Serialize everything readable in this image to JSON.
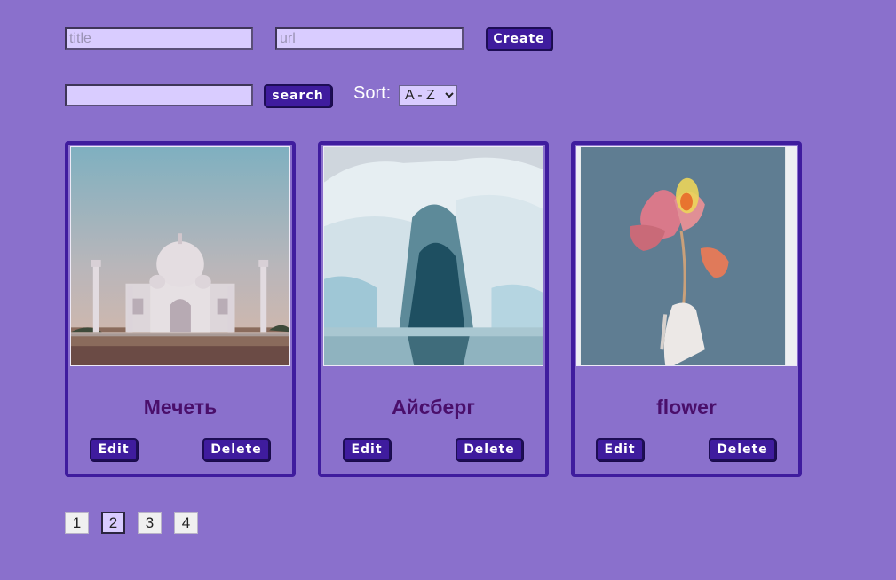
{
  "create_form": {
    "title_placeholder": "title",
    "url_placeholder": "url",
    "create_label": "Create"
  },
  "search_bar": {
    "search_value": "",
    "search_label": "search"
  },
  "sort": {
    "label": "Sort:",
    "selected": "A - Z",
    "options": [
      "A - Z"
    ]
  },
  "cards": [
    {
      "title": "Мечеть",
      "edit_label": "Edit",
      "delete_label": "Delete"
    },
    {
      "title": "Айсберг",
      "edit_label": "Edit",
      "delete_label": "Delete"
    },
    {
      "title": "flower",
      "edit_label": "Edit",
      "delete_label": "Delete"
    }
  ],
  "pagination": {
    "pages": [
      "1",
      "2",
      "3",
      "4"
    ],
    "current": "2"
  },
  "colors": {
    "background": "#8a70cc",
    "button": "#3f1c9e",
    "input_fill": "#d9ccff",
    "card_title": "#4a0f6b"
  }
}
